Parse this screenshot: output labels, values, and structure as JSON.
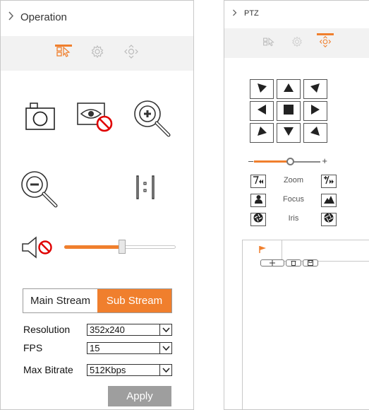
{
  "operation_panel": {
    "title": "Operation",
    "tabs": [
      {
        "icon": "live-operation-icon",
        "active": true
      },
      {
        "icon": "settings-gear-icon",
        "active": false
      },
      {
        "icon": "ptz-direction-icon",
        "active": false
      }
    ],
    "tools": [
      {
        "name": "snapshot",
        "icon": "camera-icon"
      },
      {
        "name": "privacy",
        "icon": "eye-blocked-icon"
      },
      {
        "name": "zoom-in",
        "icon": "zoom-in-icon"
      },
      {
        "name": "zoom-out",
        "icon": "zoom-out-icon"
      },
      {
        "name": "original-size",
        "icon": "one-to-one-icon"
      }
    ],
    "audio": {
      "icon": "speaker-muted-icon",
      "volume_fraction": 0.52
    },
    "stream": {
      "main_label": "Main Stream",
      "sub_label": "Sub Stream",
      "active": "sub"
    },
    "resolution": {
      "label": "Resolution",
      "value": "352x240"
    },
    "fps": {
      "label": "FPS",
      "value": "15"
    },
    "bitrate": {
      "label": "Max Bitrate",
      "value": "512Kbps"
    },
    "apply_label": "Apply",
    "colors": {
      "accent": "#f07f2d",
      "apply_bg": "#9e9e9e",
      "tab_bar_bg": "#f2f2f2"
    }
  },
  "ptz_panel": {
    "title": "PTZ",
    "tabs": [
      {
        "icon": "live-operation-icon",
        "active": false
      },
      {
        "icon": "settings-gear-icon",
        "active": false
      },
      {
        "icon": "ptz-direction-icon",
        "active": true
      }
    ],
    "directions": [
      "up-left",
      "up",
      "up-right",
      "left",
      "stop",
      "right",
      "down-left",
      "down",
      "down-right"
    ],
    "speed": {
      "minus": "–",
      "plus": "+",
      "value_fraction": 0.5
    },
    "zoom": {
      "label": "Zoom"
    },
    "focus": {
      "label": "Focus"
    },
    "iris": {
      "label": "Iris"
    },
    "preset": {
      "tab_icon": "flag-icon",
      "buttons": [
        "add-icon",
        "delete-icon",
        "save-icon"
      ]
    }
  }
}
